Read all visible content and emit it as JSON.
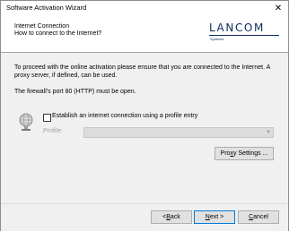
{
  "window": {
    "title": "Software Activation Wizard",
    "close_icon": "close-icon"
  },
  "header": {
    "title": "Internet Connection",
    "subtitle": "How to connect to the Internet?",
    "logo_text": "LANCOM",
    "logo_sub": "Systems",
    "brand_color": "#0b2b5e"
  },
  "content": {
    "paragraph1": "To proceed with the online activation please ensure that you are connected to the Internet. A proxy server, if defined, can be used.",
    "paragraph2": "The firewall's port 80 (HTTP) must be open.",
    "checkbox_label": "Establish an internet connection using a profile entry",
    "checkbox_checked": false,
    "profile_label": "Profile:",
    "profile_value": "",
    "proxy_button": {
      "pre": "Pro",
      "mn": "x",
      "post": "y Settings ..."
    }
  },
  "footer": {
    "back": {
      "pre": "< ",
      "mn": "B",
      "post": "ack"
    },
    "next": {
      "pre": "",
      "mn": "N",
      "post": "ext >"
    },
    "cancel": {
      "pre": "",
      "mn": "C",
      "post": "ancel"
    }
  }
}
